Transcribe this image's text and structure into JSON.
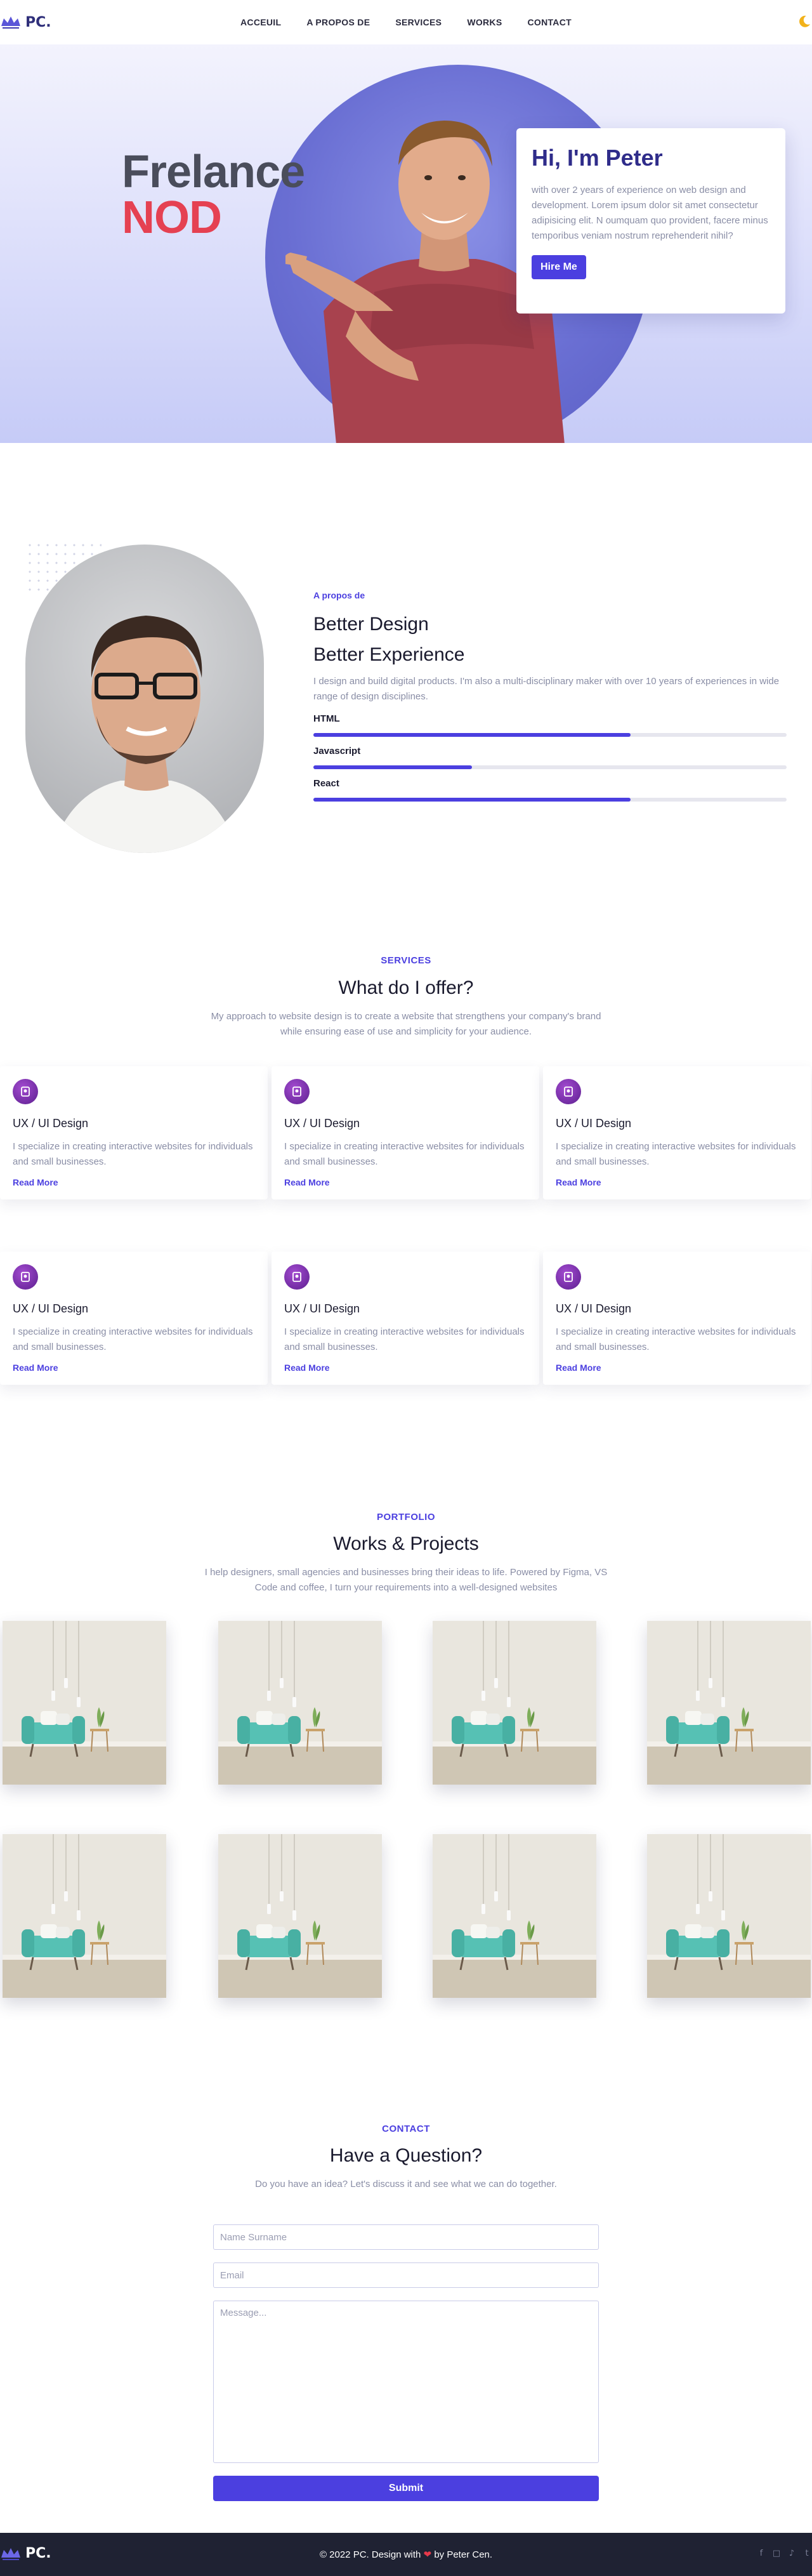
{
  "brand": {
    "name": "PC."
  },
  "nav": {
    "links": [
      "ACCEUIL",
      "A PROPOS DE",
      "SERVICES",
      "WORKS",
      "CONTACT"
    ],
    "theme_icon": "moon-icon"
  },
  "hero": {
    "title_line1": "Frelance",
    "title_line2": "NOD",
    "card_title": "Hi, I'm Peter",
    "card_text": "with over 2 years of experience on web design and development. Lorem ipsum dolor sit amet consectetur adipisicing elit. N oumquam quo provident, facere minus temporibus veniam nostrum reprehenderit nihil?",
    "cta_label": "Hire Me",
    "colors": {
      "title_dark": "#4a4d5b",
      "title_accent": "#e54152",
      "primary": "#4b3fe0"
    }
  },
  "about": {
    "eyebrow": "A propos de",
    "heading_line1": "Better Design",
    "heading_line2": "Better Experience",
    "text": "I design and build digital products. I'm also a multi-disciplinary maker with over 10 years of experiences in wide range of design disciplines.",
    "skills": [
      {
        "label": "HTML",
        "level": 0.67
      },
      {
        "label": "Javascript",
        "level": 0.335
      },
      {
        "label": "React",
        "level": 0.67
      }
    ]
  },
  "services": {
    "eyebrow": "SERVICES",
    "title": "What do I offer?",
    "description": "My approach to website design is to create a website that strengthens your company's brand while ensuring ease of use and simplicity for your audience.",
    "items": [
      {
        "title": "UX / UI Design",
        "text": "I specialize in creating interactive websites for individuals and small businesses.",
        "link": "Read More",
        "icon": "design-icon"
      },
      {
        "title": "UX / UI Design",
        "text": "I specialize in creating interactive websites for individuals and small businesses.",
        "link": "Read More",
        "icon": "design-icon"
      },
      {
        "title": "UX / UI Design",
        "text": "I specialize in creating interactive websites for individuals and small businesses.",
        "link": "Read More",
        "icon": "design-icon"
      },
      {
        "title": "UX / UI Design",
        "text": "I specialize in creating interactive websites for individuals and small businesses.",
        "link": "Read More",
        "icon": "design-icon"
      },
      {
        "title": "UX / UI Design",
        "text": "I specialize in creating interactive websites for individuals and small businesses.",
        "link": "Read More",
        "icon": "design-icon"
      },
      {
        "title": "UX / UI Design",
        "text": "I specialize in creating interactive websites for individuals and small businesses.",
        "link": "Read More",
        "icon": "design-icon"
      }
    ]
  },
  "portfolio": {
    "eyebrow": "PORTFOLIO",
    "title": "Works & Projects",
    "description": "I help designers, small agencies and businesses bring their ideas to life. Powered by Figma, VS Code and coffee, I turn your requirements into a well-designed websites"
  },
  "contact": {
    "eyebrow": "CONTACT",
    "title": "Have a Question?",
    "description": "Do you have an idea? Let's discuss it and see what we can do together.",
    "name_placeholder": "Name Surname",
    "email_placeholder": "Email",
    "message_placeholder": "Message...",
    "submit_label": "Submit"
  },
  "footer": {
    "brand": "PC.",
    "copy_before": "© 2022 PC. Design with",
    "copy_after": "by Peter Cen.",
    "heart_icon": "heart-icon",
    "socials": [
      "facebook-icon",
      "instagram-icon",
      "tiktok-icon",
      "twitter-icon"
    ]
  }
}
